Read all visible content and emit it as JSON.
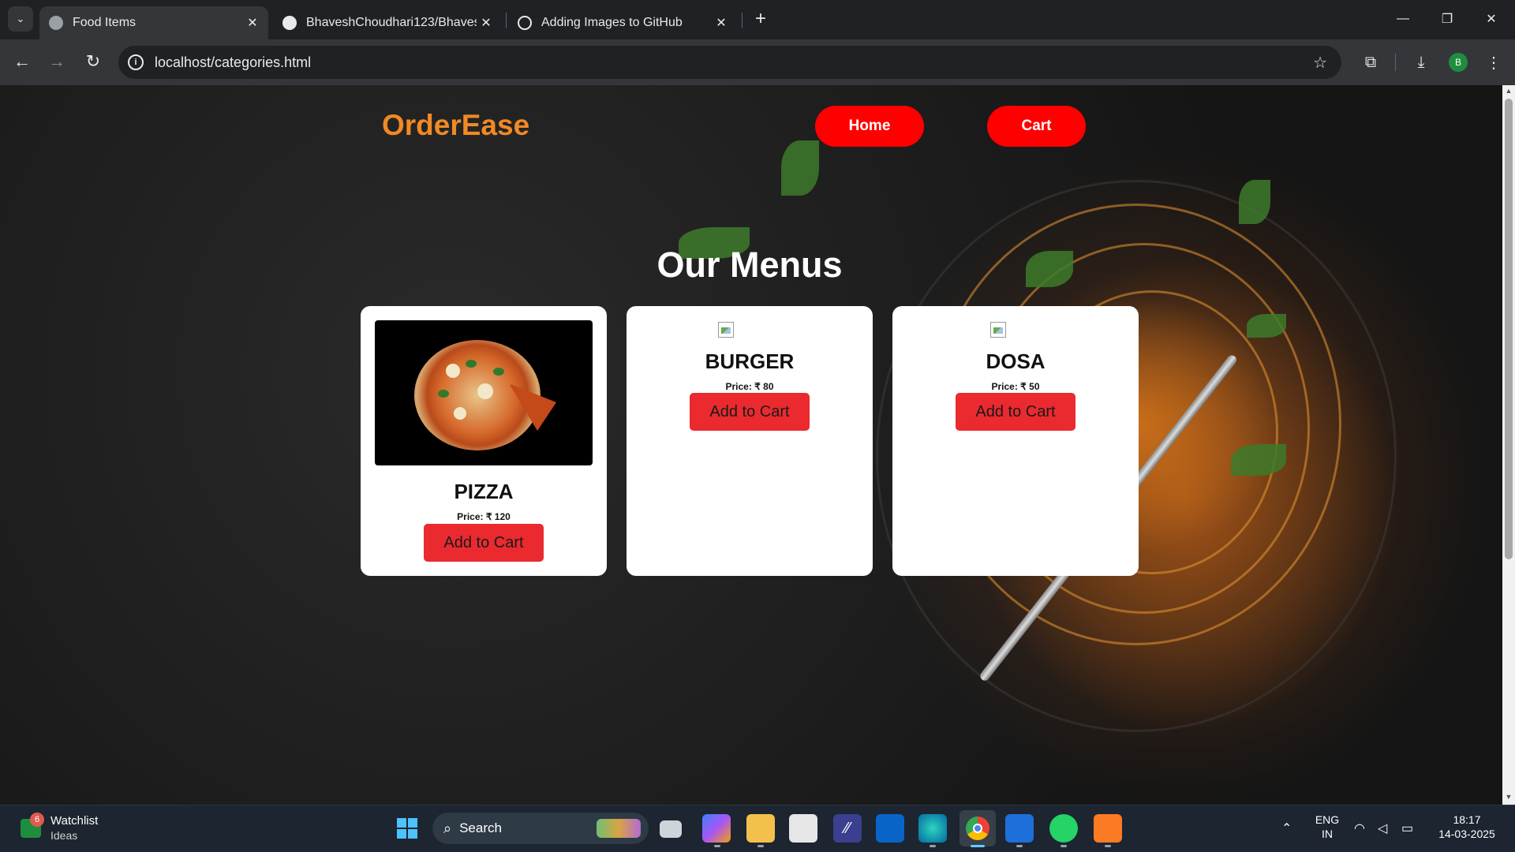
{
  "browser": {
    "tabs": [
      {
        "title": "Food Items",
        "active": true
      },
      {
        "title": "BhaveshChoudhari123/Bhavesh",
        "active": false
      },
      {
        "title": "Adding Images to GitHub",
        "active": false
      }
    ],
    "url": "localhost/categories.html",
    "profile_initial": "B",
    "icons": {
      "back": "←",
      "forward": "→",
      "reload": "↻",
      "info": "i",
      "star": "☆",
      "extensions": "⧉",
      "download": "⤓",
      "menu": "⋮",
      "newtab": "+",
      "close": "✕",
      "minimize": "—",
      "restore": "❐",
      "tablist": "⌄"
    }
  },
  "site": {
    "brand": "OrderEase",
    "nav": {
      "home": "Home",
      "cart": "Cart"
    },
    "heading": "Our Menus",
    "items": [
      {
        "name": "PIZZA",
        "price": "Price: ₹ 120",
        "button": "Add to Cart",
        "image": "pizza-photo"
      },
      {
        "name": "BURGER",
        "price": "Price: ₹ 80",
        "button": "Add to Cart",
        "image": "broken-image"
      },
      {
        "name": "DOSA",
        "price": "Price: ₹ 50",
        "button": "Add to Cart",
        "image": "broken-image"
      }
    ],
    "colors": {
      "brand": "#f08a24",
      "nav_button": "#ff0000",
      "add_button": "#ea2a2f"
    }
  },
  "taskbar": {
    "widget": {
      "badge": "6",
      "title": "Watchlist",
      "subtitle": "Ideas"
    },
    "search_placeholder": "Search",
    "language": {
      "line1": "ENG",
      "line2": "IN"
    },
    "time": "18:17",
    "date": "14-03-2025"
  }
}
